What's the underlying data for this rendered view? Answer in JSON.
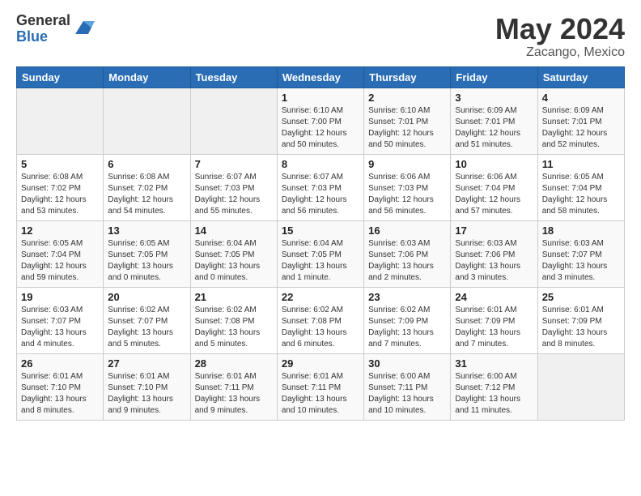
{
  "header": {
    "logo_general": "General",
    "logo_blue": "Blue",
    "month_year": "May 2024",
    "location": "Zacango, Mexico"
  },
  "weekdays": [
    "Sunday",
    "Monday",
    "Tuesday",
    "Wednesday",
    "Thursday",
    "Friday",
    "Saturday"
  ],
  "weeks": [
    [
      {
        "day": "",
        "info": ""
      },
      {
        "day": "",
        "info": ""
      },
      {
        "day": "",
        "info": ""
      },
      {
        "day": "1",
        "info": "Sunrise: 6:10 AM\nSunset: 7:00 PM\nDaylight: 12 hours\nand 50 minutes."
      },
      {
        "day": "2",
        "info": "Sunrise: 6:10 AM\nSunset: 7:01 PM\nDaylight: 12 hours\nand 50 minutes."
      },
      {
        "day": "3",
        "info": "Sunrise: 6:09 AM\nSunset: 7:01 PM\nDaylight: 12 hours\nand 51 minutes."
      },
      {
        "day": "4",
        "info": "Sunrise: 6:09 AM\nSunset: 7:01 PM\nDaylight: 12 hours\nand 52 minutes."
      }
    ],
    [
      {
        "day": "5",
        "info": "Sunrise: 6:08 AM\nSunset: 7:02 PM\nDaylight: 12 hours\nand 53 minutes."
      },
      {
        "day": "6",
        "info": "Sunrise: 6:08 AM\nSunset: 7:02 PM\nDaylight: 12 hours\nand 54 minutes."
      },
      {
        "day": "7",
        "info": "Sunrise: 6:07 AM\nSunset: 7:03 PM\nDaylight: 12 hours\nand 55 minutes."
      },
      {
        "day": "8",
        "info": "Sunrise: 6:07 AM\nSunset: 7:03 PM\nDaylight: 12 hours\nand 56 minutes."
      },
      {
        "day": "9",
        "info": "Sunrise: 6:06 AM\nSunset: 7:03 PM\nDaylight: 12 hours\nand 56 minutes."
      },
      {
        "day": "10",
        "info": "Sunrise: 6:06 AM\nSunset: 7:04 PM\nDaylight: 12 hours\nand 57 minutes."
      },
      {
        "day": "11",
        "info": "Sunrise: 6:05 AM\nSunset: 7:04 PM\nDaylight: 12 hours\nand 58 minutes."
      }
    ],
    [
      {
        "day": "12",
        "info": "Sunrise: 6:05 AM\nSunset: 7:04 PM\nDaylight: 12 hours\nand 59 minutes."
      },
      {
        "day": "13",
        "info": "Sunrise: 6:05 AM\nSunset: 7:05 PM\nDaylight: 13 hours\nand 0 minutes."
      },
      {
        "day": "14",
        "info": "Sunrise: 6:04 AM\nSunset: 7:05 PM\nDaylight: 13 hours\nand 0 minutes."
      },
      {
        "day": "15",
        "info": "Sunrise: 6:04 AM\nSunset: 7:05 PM\nDaylight: 13 hours\nand 1 minute."
      },
      {
        "day": "16",
        "info": "Sunrise: 6:03 AM\nSunset: 7:06 PM\nDaylight: 13 hours\nand 2 minutes."
      },
      {
        "day": "17",
        "info": "Sunrise: 6:03 AM\nSunset: 7:06 PM\nDaylight: 13 hours\nand 3 minutes."
      },
      {
        "day": "18",
        "info": "Sunrise: 6:03 AM\nSunset: 7:07 PM\nDaylight: 13 hours\nand 3 minutes."
      }
    ],
    [
      {
        "day": "19",
        "info": "Sunrise: 6:03 AM\nSunset: 7:07 PM\nDaylight: 13 hours\nand 4 minutes."
      },
      {
        "day": "20",
        "info": "Sunrise: 6:02 AM\nSunset: 7:07 PM\nDaylight: 13 hours\nand 5 minutes."
      },
      {
        "day": "21",
        "info": "Sunrise: 6:02 AM\nSunset: 7:08 PM\nDaylight: 13 hours\nand 5 minutes."
      },
      {
        "day": "22",
        "info": "Sunrise: 6:02 AM\nSunset: 7:08 PM\nDaylight: 13 hours\nand 6 minutes."
      },
      {
        "day": "23",
        "info": "Sunrise: 6:02 AM\nSunset: 7:09 PM\nDaylight: 13 hours\nand 7 minutes."
      },
      {
        "day": "24",
        "info": "Sunrise: 6:01 AM\nSunset: 7:09 PM\nDaylight: 13 hours\nand 7 minutes."
      },
      {
        "day": "25",
        "info": "Sunrise: 6:01 AM\nSunset: 7:09 PM\nDaylight: 13 hours\nand 8 minutes."
      }
    ],
    [
      {
        "day": "26",
        "info": "Sunrise: 6:01 AM\nSunset: 7:10 PM\nDaylight: 13 hours\nand 8 minutes."
      },
      {
        "day": "27",
        "info": "Sunrise: 6:01 AM\nSunset: 7:10 PM\nDaylight: 13 hours\nand 9 minutes."
      },
      {
        "day": "28",
        "info": "Sunrise: 6:01 AM\nSunset: 7:11 PM\nDaylight: 13 hours\nand 9 minutes."
      },
      {
        "day": "29",
        "info": "Sunrise: 6:01 AM\nSunset: 7:11 PM\nDaylight: 13 hours\nand 10 minutes."
      },
      {
        "day": "30",
        "info": "Sunrise: 6:00 AM\nSunset: 7:11 PM\nDaylight: 13 hours\nand 10 minutes."
      },
      {
        "day": "31",
        "info": "Sunrise: 6:00 AM\nSunset: 7:12 PM\nDaylight: 13 hours\nand 11 minutes."
      },
      {
        "day": "",
        "info": ""
      }
    ]
  ]
}
